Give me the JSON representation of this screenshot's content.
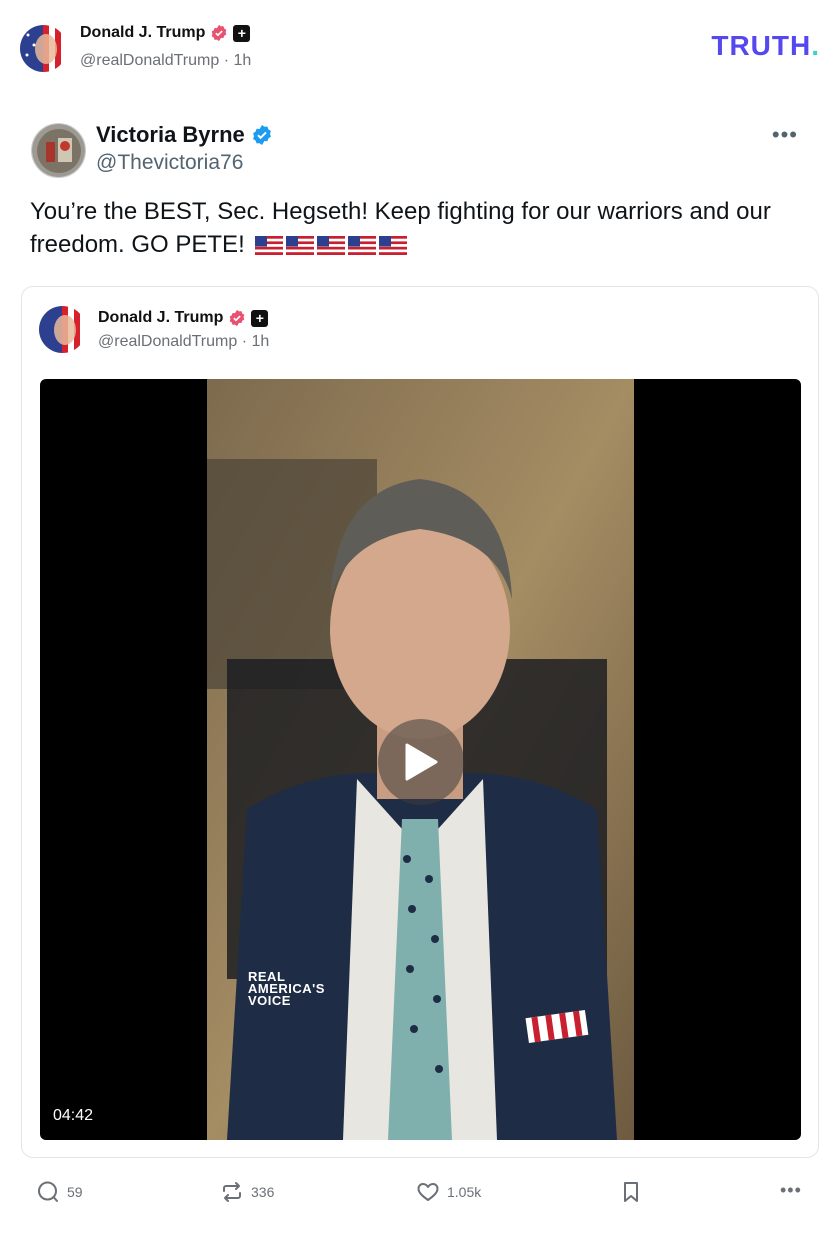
{
  "header": {
    "author_name": "Donald J. Trump",
    "handle": "@realDonaldTrump",
    "time": "1h",
    "separator": "·",
    "logo_text": "TRUTH",
    "logo_dot": "."
  },
  "quoted_post": {
    "author_name": "Victoria Byrne",
    "handle": "@Thevictoria76",
    "text": "You’re the BEST, Sec. Hegseth! Keep fighting for our warriors and our freedom. GO PETE!",
    "more_icon": "more-horizontal-icon",
    "flag_count": 5
  },
  "card": {
    "author_name": "Donald J. Trump",
    "handle": "@realDonaldTrump",
    "time": "1h",
    "separator": "·",
    "video": {
      "duration": "04:42",
      "watermark_line1": "REAL",
      "watermark_line2": "AMERICA'S",
      "watermark_line3": "VOICE"
    }
  },
  "actions": {
    "replies": "59",
    "reposts": "336",
    "likes": "1.05k"
  },
  "colors": {
    "brand": "#5448ee",
    "brand_dot": "#3fd3c2",
    "verified_pink": "#e8526f",
    "verified_blue": "#1d9bf0",
    "muted": "#6b6f76"
  }
}
